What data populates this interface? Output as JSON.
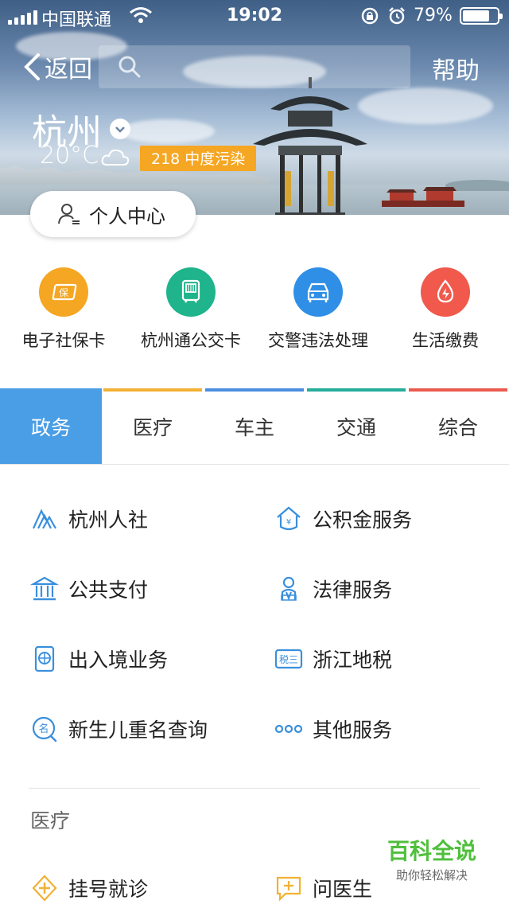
{
  "status_bar": {
    "carrier": "中国联通",
    "time": "19:02",
    "battery": "79%",
    "battery_level": 0.79
  },
  "nav": {
    "back_label": "返回",
    "search_placeholder": "",
    "help_label": "帮助"
  },
  "weather": {
    "city": "杭州",
    "temperature": "20°C",
    "aqi": "218 中度污染",
    "aqi_color": "#f5a623"
  },
  "personal_center": {
    "label": "个人中心"
  },
  "quick_actions": [
    {
      "label": "电子社保卡",
      "icon": "social-security-card-icon",
      "color": "#f5a623"
    },
    {
      "label": "杭州通公交卡",
      "icon": "bus-card-icon",
      "color": "#1fb48b"
    },
    {
      "label": "交警违法处理",
      "icon": "car-icon",
      "color": "#2f8fe6"
    },
    {
      "label": "生活缴费",
      "icon": "utility-bill-icon",
      "color": "#f0594c"
    }
  ],
  "tabs": [
    {
      "label": "政务",
      "color": "#4a9ee5",
      "active": true
    },
    {
      "label": "医疗",
      "color": "#f2b134",
      "active": false
    },
    {
      "label": "车主",
      "color": "#4a8ee0",
      "active": false
    },
    {
      "label": "交通",
      "color": "#25ad9b",
      "active": false
    },
    {
      "label": "综合",
      "color": "#ea5a4e",
      "active": false
    }
  ],
  "services": [
    {
      "label": "杭州人社",
      "icon": "hangzhou-hr-icon"
    },
    {
      "label": "公积金服务",
      "icon": "housing-fund-icon"
    },
    {
      "label": "公共支付",
      "icon": "public-payment-icon"
    },
    {
      "label": "法律服务",
      "icon": "legal-service-icon"
    },
    {
      "label": "出入境业务",
      "icon": "passport-icon"
    },
    {
      "label": "浙江地税",
      "icon": "tax-icon"
    },
    {
      "label": "新生儿重名查询",
      "icon": "name-search-icon"
    },
    {
      "label": "其他服务",
      "icon": "more-services-icon"
    }
  ],
  "medical_section": {
    "title": "医疗",
    "items": [
      {
        "label": "挂号就诊",
        "icon": "registration-icon"
      },
      {
        "label": "问医生",
        "icon": "ask-doctor-icon"
      }
    ]
  },
  "watermark": {
    "title": "百科全说",
    "subtitle": "助你轻松解决"
  },
  "colors": {
    "accent": "#4a9ee5",
    "icon_blue": "#3a8fdd"
  }
}
